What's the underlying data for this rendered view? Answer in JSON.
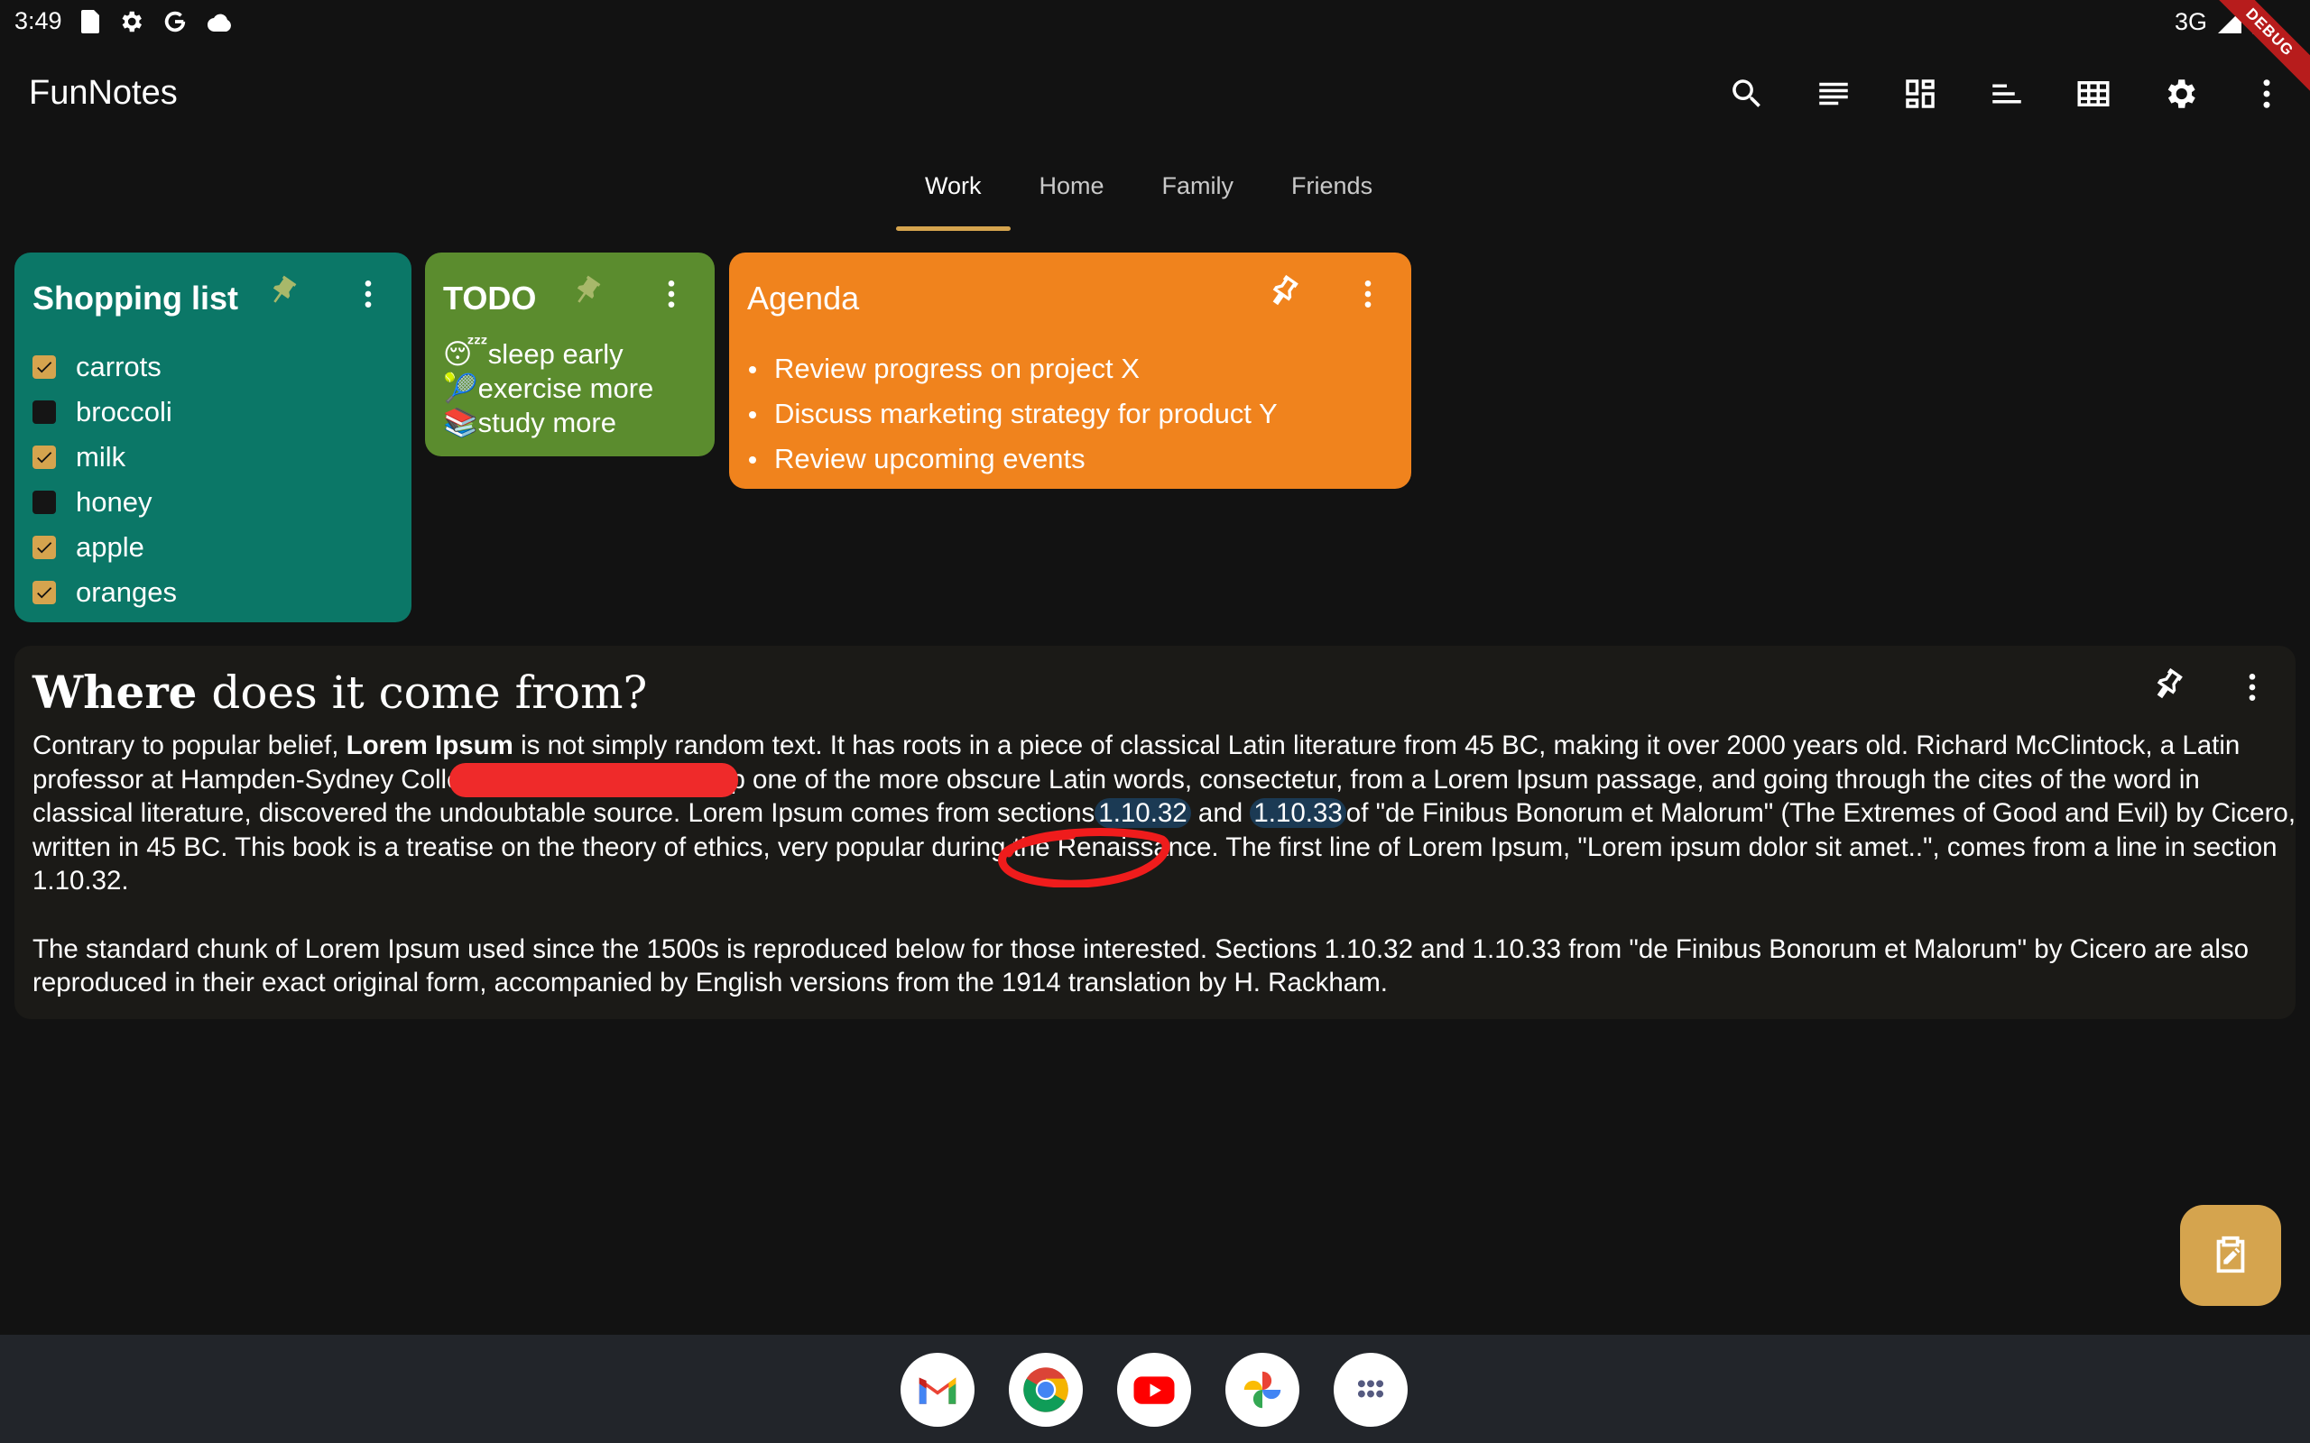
{
  "status_bar": {
    "time": "3:49",
    "network": "3G",
    "left_icons": [
      "sd-card-icon",
      "settings-gear-icon",
      "google-icon",
      "cloud-icon"
    ],
    "right_icons": [
      "signal-icon",
      "battery-icon"
    ],
    "debug_banner": "DEBUG"
  },
  "app_bar": {
    "title": "FunNotes",
    "actions": [
      "search-icon",
      "list-view-icon",
      "dashboard-view-icon",
      "sort-icon",
      "grid-view-icon",
      "settings-icon",
      "more-vert-icon"
    ]
  },
  "tabs": [
    {
      "label": "Work",
      "active": true
    },
    {
      "label": "Home",
      "active": false
    },
    {
      "label": "Family",
      "active": false
    },
    {
      "label": "Friends",
      "active": false
    }
  ],
  "notes": {
    "shopping": {
      "title": "Shopping list",
      "color": "#0b7767",
      "items": [
        {
          "label": "carrots",
          "checked": true
        },
        {
          "label": "broccoli",
          "checked": false
        },
        {
          "label": "milk",
          "checked": true
        },
        {
          "label": "honey",
          "checked": false
        },
        {
          "label": "apple",
          "checked": true
        },
        {
          "label": "oranges",
          "checked": true
        }
      ]
    },
    "todo": {
      "title": "TODO",
      "color": "#5b8c2e",
      "lines": [
        {
          "emoji": "😴",
          "text": "sleep early"
        },
        {
          "emoji": "🎾",
          "text": "exercise more"
        },
        {
          "emoji": "📚",
          "text": "study more"
        }
      ]
    },
    "agenda": {
      "title": "Agenda",
      "color": "#f0831d",
      "items": [
        "Review progress on project X",
        "Discuss marketing strategy for product Y",
        "Review upcoming events"
      ]
    },
    "article": {
      "title_bold": "Where",
      "title_rest": " does it come from?",
      "p1_a": "Contrary to popular belief, ",
      "p1_bold": "Lorem Ipsum",
      "p1_b": " is not simply random text. It has roots in a piece of classical Latin literature from 45 BC, making it over 2000 years old. Richard McClintock, a Latin professor at Hampden-Sydney College in Virginia, looked up one of the more obscure Latin words, consectetur, from a Lorem Ipsum passage, and going through the cites of the word in classical literature, discovered the undoubtable source. Lorem Ipsum comes from sections",
      "p1_hl1": "1.10.32",
      "p1_and": " and ",
      "p1_hl2": "1.10.33",
      "p1_c": "of \"de Finibus Bonorum et Malorum\" (The Extremes of Good and Evil) by Cicero, written in 45 BC. This book is a treatise on the theory of ethics, very popular during the Renaissance. The first line of Lorem Ipsum, \"Lorem ipsum dolor sit amet..\", comes from a line in section 1.10.32.",
      "p2": "The standard chunk of Lorem Ipsum used since the 1500s is reproduced below for those interested. Sections 1.10.32 and 1.10.33 from \"de Finibus Bonorum et Malorum\" by Cicero are also reproduced in their exact original form, accompanied by English versions from the 1914 translation by H. Rackham."
    }
  },
  "fab_icon": "edit-note-icon",
  "dock_apps": [
    "gmail-icon",
    "chrome-icon",
    "youtube-icon",
    "photos-icon",
    "app-drawer-icon"
  ],
  "colors": {
    "accent": "#d5a44e",
    "background": "#121212",
    "card_dark": "#1b1a17",
    "highlight": "#1b3a54"
  }
}
